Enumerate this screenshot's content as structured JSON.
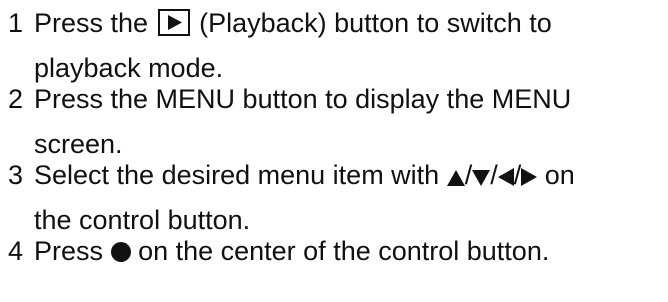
{
  "steps": [
    {
      "number": "1",
      "line1_pre": "Press the",
      "line1_post": "(Playback) button to switch to",
      "line2": "playback mode.",
      "icon": "playback-icon"
    },
    {
      "number": "2",
      "line1": "Press the MENU button to display the MENU",
      "line2": "screen."
    },
    {
      "number": "3",
      "line1_pre": "Select the desired menu item with",
      "line1_post": "on",
      "line2": "the control button.",
      "icons": [
        "triangle-up-icon",
        "triangle-down-icon",
        "triangle-left-icon",
        "triangle-right-icon"
      ],
      "separator": "/"
    },
    {
      "number": "4",
      "line1_pre": "Press",
      "line1_post": "on the center of the control button.",
      "icon": "filled-circle-icon"
    }
  ]
}
